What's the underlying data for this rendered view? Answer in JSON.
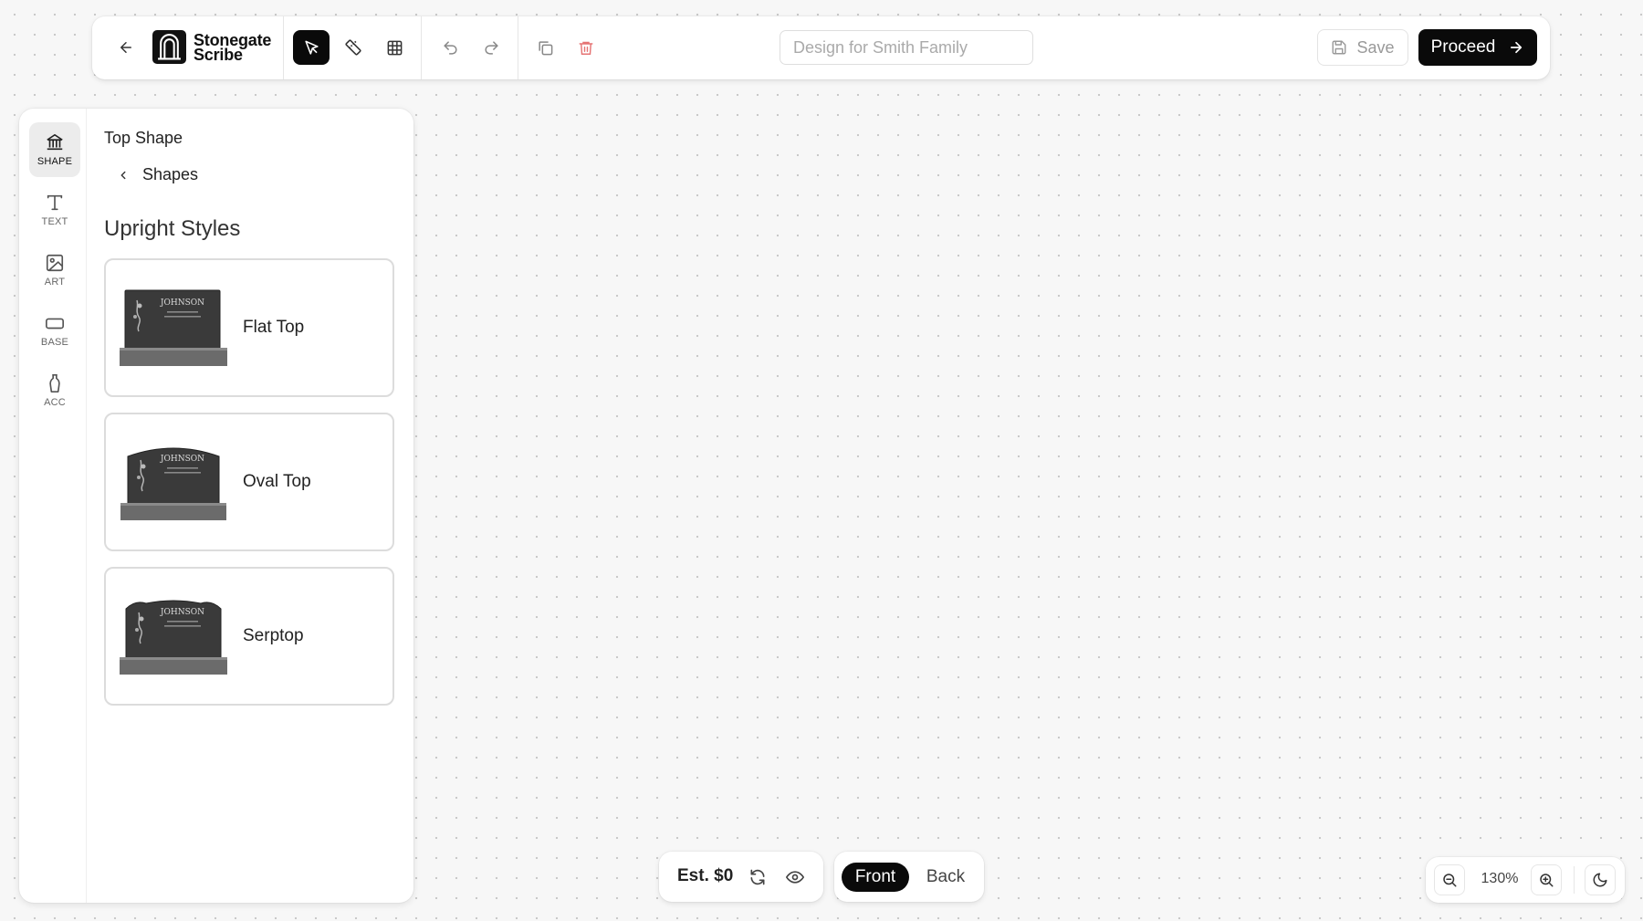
{
  "brand": {
    "line1": "Stonegate",
    "line2": "Scribe"
  },
  "toolbar": {
    "design_name_placeholder": "Design for Smith Family",
    "design_name_value": "",
    "save_label": "Save",
    "proceed_label": "Proceed",
    "active_tool": "select",
    "icons": [
      "back-arrow-icon",
      "select-cursor-icon",
      "ruler-icon",
      "grid-icon",
      "undo-icon",
      "redo-icon",
      "duplicate-icon",
      "trash-icon",
      "save-icon",
      "arrow-right-icon"
    ]
  },
  "rail": {
    "items": [
      {
        "label": "SHAPE",
        "icon": "monument-icon",
        "active": true
      },
      {
        "label": "TEXT",
        "icon": "text-icon",
        "active": false
      },
      {
        "label": "ART",
        "icon": "image-icon",
        "active": false
      },
      {
        "label": "BASE",
        "icon": "base-icon",
        "active": false
      },
      {
        "label": "ACC",
        "icon": "vase-icon",
        "active": false
      }
    ]
  },
  "panel": {
    "section_title": "Top Shape",
    "breadcrumb": "Shapes",
    "group_title": "Upright Styles",
    "shapes": [
      {
        "label": "Flat Top",
        "thumb_name": "JOHNSON"
      },
      {
        "label": "Oval Top",
        "thumb_name": "JOHNSON"
      },
      {
        "label": "Serptop",
        "thumb_name": "JOHNSON"
      }
    ]
  },
  "bottom": {
    "estimate": "Est. $0",
    "side_front": "Front",
    "side_back": "Back",
    "active_side": "Front",
    "zoom_level": "130%"
  },
  "colors": {
    "accent": "#0a0a0a",
    "delete": "#e57373",
    "background": "#f7f7f7"
  }
}
